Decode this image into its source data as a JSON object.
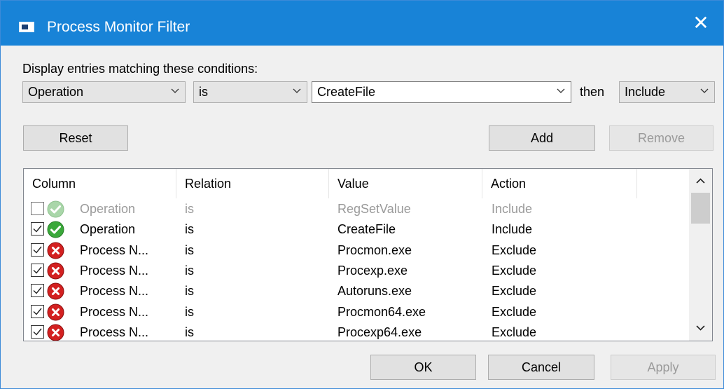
{
  "window": {
    "title": "Process Monitor Filter",
    "close_glyph": "✕"
  },
  "conditions_label": "Display entries matching these conditions:",
  "filter": {
    "column": "Operation",
    "relation": "is",
    "value": "CreateFile",
    "then_label": "then",
    "action": "Include"
  },
  "buttons": {
    "reset": "Reset",
    "add": "Add",
    "remove": "Remove",
    "ok": "OK",
    "cancel": "Cancel",
    "apply": "Apply"
  },
  "table": {
    "headers": {
      "column": "Column",
      "relation": "Relation",
      "value": "Value",
      "action": "Action"
    },
    "rows": [
      {
        "checked": false,
        "enabled": false,
        "status_icon": "check-icon",
        "column": "Operation",
        "relation": "is",
        "value": "RegSetValue",
        "action": "Include"
      },
      {
        "checked": true,
        "enabled": true,
        "status_icon": "check-icon",
        "column": "Operation",
        "relation": "is",
        "value": "CreateFile",
        "action": "Include"
      },
      {
        "checked": true,
        "enabled": true,
        "status_icon": "exclude-icon",
        "column": "Process N...",
        "relation": "is",
        "value": "Procmon.exe",
        "action": "Exclude"
      },
      {
        "checked": true,
        "enabled": true,
        "status_icon": "exclude-icon",
        "column": "Process N...",
        "relation": "is",
        "value": "Procexp.exe",
        "action": "Exclude"
      },
      {
        "checked": true,
        "enabled": true,
        "status_icon": "exclude-icon",
        "column": "Process N...",
        "relation": "is",
        "value": "Autoruns.exe",
        "action": "Exclude"
      },
      {
        "checked": true,
        "enabled": true,
        "status_icon": "exclude-icon",
        "column": "Process N...",
        "relation": "is",
        "value": "Procmon64.exe",
        "action": "Exclude"
      },
      {
        "checked": true,
        "enabled": true,
        "status_icon": "exclude-icon",
        "column": "Process N...",
        "relation": "is",
        "value": "Procexp64.exe",
        "action": "Exclude"
      }
    ]
  },
  "colors": {
    "titlebar": "#1883d7",
    "include_green": "#3aa83a",
    "exclude_red": "#d32020",
    "disabled_text": "#9a9a9a"
  }
}
